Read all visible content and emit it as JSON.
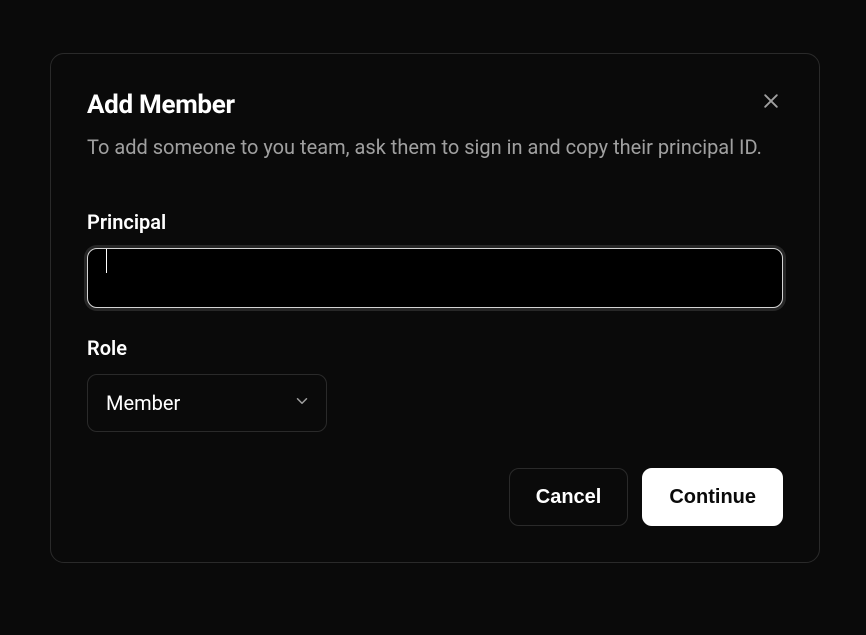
{
  "modal": {
    "title": "Add Member",
    "subtitle": "To add someone to you team, ask them to sign in and copy their principal ID."
  },
  "form": {
    "principal": {
      "label": "Principal",
      "value": ""
    },
    "role": {
      "label": "Role",
      "selected": "Member"
    }
  },
  "actions": {
    "cancel": "Cancel",
    "continue": "Continue"
  }
}
